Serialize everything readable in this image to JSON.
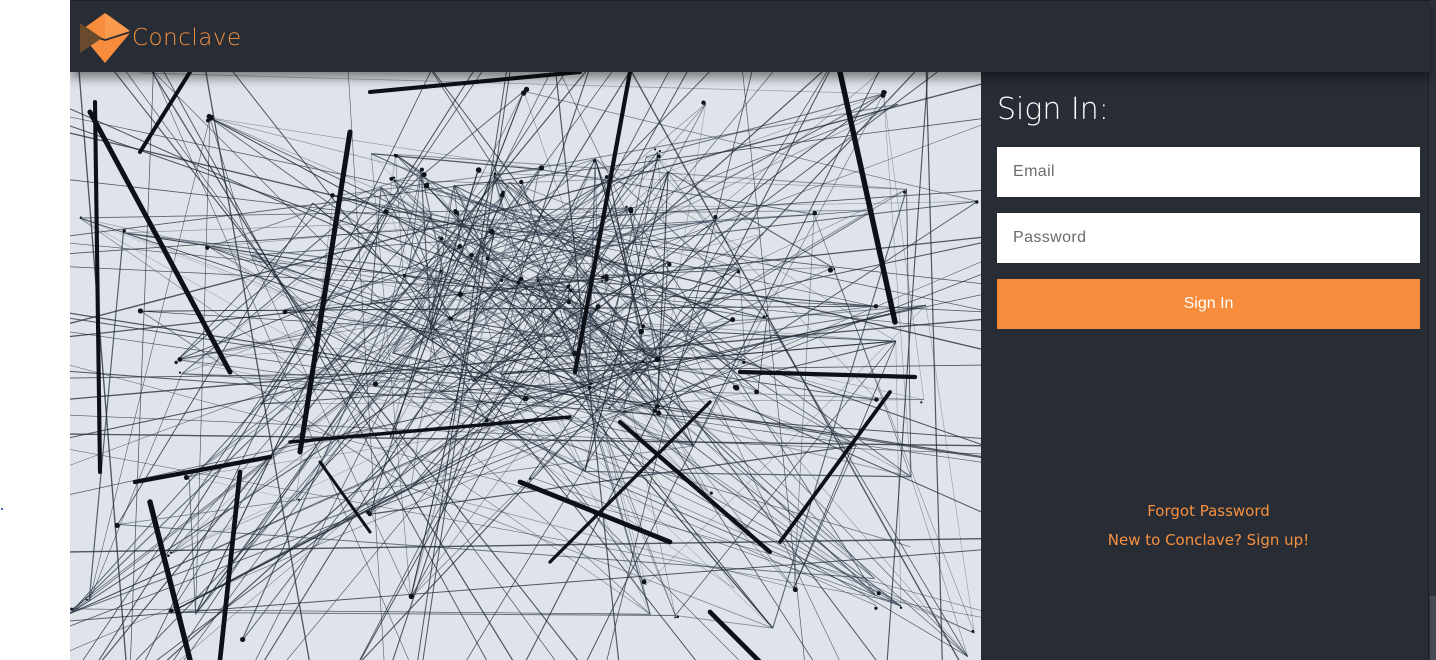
{
  "brand": {
    "name": "Conclave",
    "logo_icon": "diamond-logo-icon",
    "accent_color": "#f5913e"
  },
  "hero": {
    "image": "network-strings-photo"
  },
  "signin": {
    "title": "Sign In:",
    "email_placeholder": "Email",
    "password_placeholder": "Password",
    "button_label": "Sign In",
    "button_color": "#f78c3c",
    "forgot_label": "Forgot Password",
    "signup_label": "New to Conclave? Sign up!"
  },
  "theme": {
    "background": "#282c35",
    "text": "#ffffff"
  }
}
